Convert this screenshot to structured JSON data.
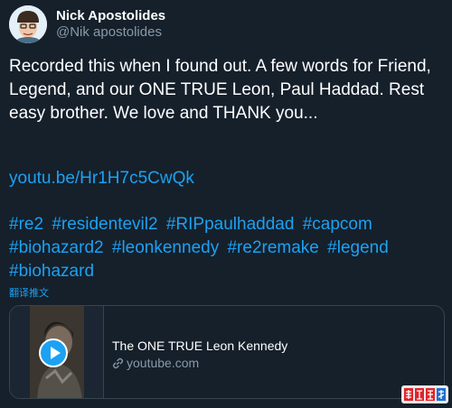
{
  "author": {
    "name": "Nick Apostolides",
    "handle": "@Nik apostolides"
  },
  "tweet": {
    "text": "Recorded this when I found out. A few words for Friend, Legend, and our ONE TRUE Leon, Paul Haddad. Rest easy brother.  We love and THANK you...",
    "link": "youtu.be/Hr1H7c5CwQk",
    "hashtags": [
      "#re2",
      "#residentevil2",
      "#RIPpaulhaddad",
      "#capcom",
      "#biohazard2",
      "#leonkennedy",
      "#re2remake",
      "#legend",
      "#biohazard"
    ],
    "translate_label": "翻译推文"
  },
  "card": {
    "title": "The ONE TRUE Leon Kennedy",
    "domain": "youtube.com"
  },
  "watermark": {
    "text": "电玩巴士"
  },
  "colors": {
    "background": "#15202b",
    "accent": "#1da1f2",
    "secondary_text": "#8899a6",
    "border": "#38444d"
  }
}
